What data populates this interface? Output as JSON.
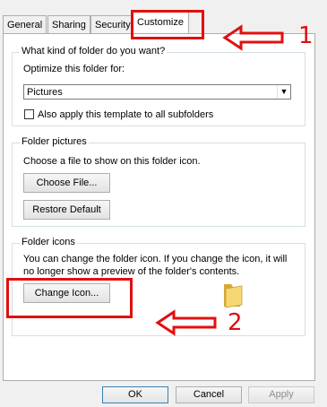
{
  "tabs": [
    {
      "label": "General"
    },
    {
      "label": "Sharing"
    },
    {
      "label": "Security"
    },
    {
      "label": "Customize",
      "selected": true
    }
  ],
  "folder_type": {
    "title": "What kind of folder do you want?",
    "optimize_label": "Optimize this folder for:",
    "selected_value": "Pictures",
    "apply_label": "Also apply this template to all subfolders",
    "apply_checked": false
  },
  "folder_pictures": {
    "title": "Folder pictures",
    "desc": "Choose a file to show on this folder icon.",
    "choose_label": "Choose File...",
    "restore_label": "Restore Default"
  },
  "folder_icons": {
    "title": "Folder icons",
    "desc_line1": "You can change the folder icon. If you change the icon, it will",
    "desc_line2": "no longer show a preview of the folder's contents.",
    "change_label": "Change Icon..."
  },
  "annotations": {
    "num1": "1",
    "num2": "2",
    "color": "#e01010"
  },
  "footer": {
    "ok": "OK",
    "cancel": "Cancel",
    "apply": "Apply"
  }
}
